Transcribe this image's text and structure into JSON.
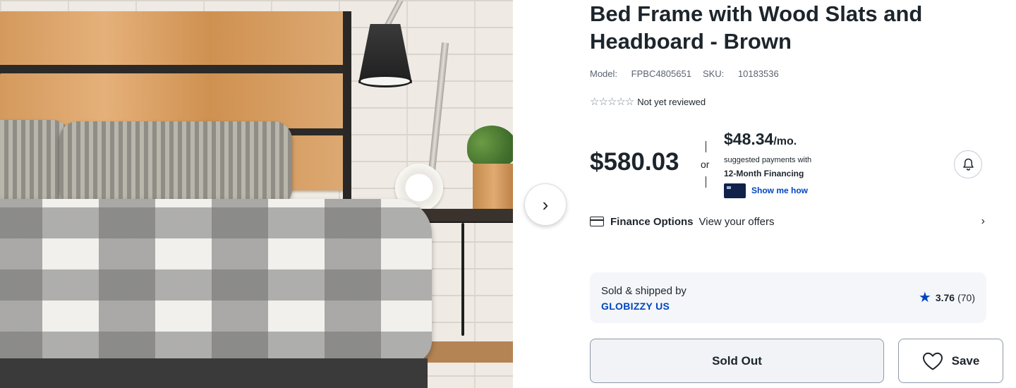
{
  "product": {
    "title": "Bed Frame with Wood Slats and Headboard - Brown",
    "model_label": "Model:",
    "model": "FPBC4805651",
    "sku_label": "SKU:",
    "sku": "10183536",
    "rating_text": "Not yet reviewed",
    "stars_filled": 0,
    "stars_total": 5,
    "image_alt_icon": "image-bed-frame"
  },
  "pricing": {
    "price": "$580.03",
    "or": "or",
    "monthly": "$48.34",
    "monthly_unit": "/mo.",
    "monthly_note": "suggested payments with",
    "financing_term": "12-Month Financing",
    "show_me_how": "Show me how"
  },
  "finance_options": {
    "label": "Finance Options",
    "link": "View your offers",
    "chevron": "›"
  },
  "seller": {
    "label": "Sold & shipped by",
    "name": "GLOBIZZY US",
    "rating": "3.76",
    "count": "(70)"
  },
  "actions": {
    "sold_out": "Sold Out",
    "save": "Save",
    "next": "›"
  },
  "icons": {
    "stars": "star-outline-icon",
    "bell": "bell-icon",
    "card": "credit-card-icon",
    "heart": "heart-icon",
    "seller_star": "star-filled-icon"
  },
  "colors": {
    "text": "#1d252c",
    "link": "#0046be",
    "muted": "#5a6470",
    "panel_bg": "#f4f6f9"
  }
}
